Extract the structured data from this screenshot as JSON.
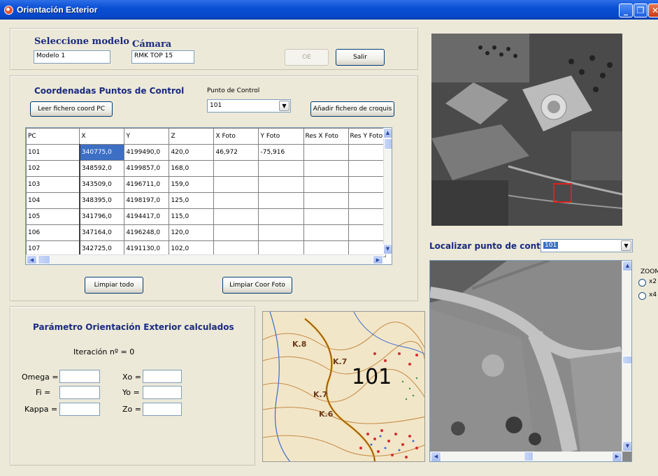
{
  "window": {
    "title": "Orientación Exterior"
  },
  "model": {
    "heading": "Seleccione modelo",
    "value": "Modelo 1"
  },
  "camera": {
    "heading": "Cámara",
    "value": "RMK TOP 15"
  },
  "buttons": {
    "oe": "OE",
    "salir": "Salir",
    "leer": "Leer fichero coord PC",
    "anadir": "Añadir fichero de croquis",
    "limpiar_todo": "Limpiar todo",
    "limpiar_foto": "Limpiar Coor Foto"
  },
  "control_points": {
    "heading": "Coordenadas Puntos de Control",
    "selector_label": "Punto de Control",
    "selector_value": "101",
    "columns": [
      "PC",
      "X",
      "Y",
      "Z",
      "X Foto",
      "Y Foto",
      "Res X Foto",
      "Res Y Foto"
    ],
    "rows": [
      [
        "101",
        "340775,0",
        "4199490,0",
        "420,0",
        "46,972",
        "-75,916",
        "",
        ""
      ],
      [
        "102",
        "348592,0",
        "4199857,0",
        "168,0",
        "",
        "",
        "",
        ""
      ],
      [
        "103",
        "343509,0",
        "4196711,0",
        "159,0",
        "",
        "",
        "",
        ""
      ],
      [
        "104",
        "348395,0",
        "4198197,0",
        "125,0",
        "",
        "",
        "",
        ""
      ],
      [
        "105",
        "341796,0",
        "4194417,0",
        "115,0",
        "",
        "",
        "",
        ""
      ],
      [
        "106",
        "347164,0",
        "4196248,0",
        "120,0",
        "",
        "",
        "",
        ""
      ],
      [
        "107",
        "342725,0",
        "4191130,0",
        "102,0",
        "",
        "",
        "",
        ""
      ]
    ]
  },
  "params": {
    "heading": "Parámetro Orientación Exterior calculados",
    "iteration": "Iteración nº = 0",
    "omega": "Omega =",
    "fi": "Fi =",
    "kappa": "Kappa =",
    "xo": "Xo =",
    "yo": "Yo =",
    "zo": "Zo ="
  },
  "map": {
    "label": "101"
  },
  "locate": {
    "label": "Localizar punto de control",
    "value": "101"
  },
  "zoom": {
    "label": "ZOOM",
    "x2": "x2",
    "x4": "x4"
  }
}
